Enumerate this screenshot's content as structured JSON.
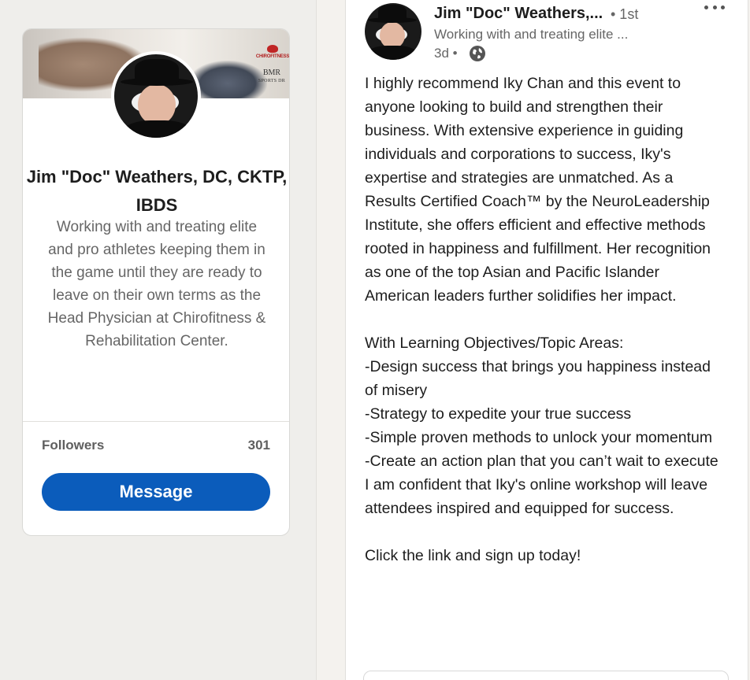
{
  "profile_card": {
    "name": "Jim \"Doc\" Weathers, DC, CKTP, IBDS",
    "headline": "Working with and treating elite and pro athletes keeping them in the game until they are ready to leave on their own terms as the Head Physician at Chirofitness & Rehabilitation Center.",
    "followers_label": "Followers",
    "followers_count": "301",
    "message_label": "Message",
    "banner_logo_top": "CHIROFITNESS",
    "banner_logo_bottom": "BMR",
    "banner_logo_bottom_sub": "SPORTS DR"
  },
  "post": {
    "author_name": "Jim \"Doc\" Weathers,...",
    "degree": "• 1st",
    "author_headline": "Working with and treating elite ...",
    "timestamp": "3d •",
    "body_paragraph_1": "I highly recommend Iky Chan and this event to anyone looking to build and strengthen their business. With extensive experience in guiding individuals and corporations to success, Iky's expertise and strategies are unmatched. As a Results Certified Coach™ by the NeuroLeadership Institute, she offers efficient and effective methods rooted in happiness and fulfillment. Her recognition as one of the top Asian and Pacific Islander American leaders further solidifies her impact.",
    "body_paragraph_2": "With Learning Objectives/Topic Areas:\n-Design success that brings you happiness instead of misery\n-Strategy to expedite your true success\n-Simple proven methods to unlock your momentum\n-Create an action plan that you can’t wait to execute\nI am confident that Iky's online workshop will leave attendees inspired and equipped for success.",
    "body_paragraph_3": "Click the link and sign up today!"
  },
  "colors": {
    "primary_button": "#0b5cbb",
    "page_background": "#f4f2ee",
    "secondary_text": "#666666"
  },
  "icons": {
    "visibility": "globe-icon",
    "menu": "more-horizontal-icon"
  }
}
